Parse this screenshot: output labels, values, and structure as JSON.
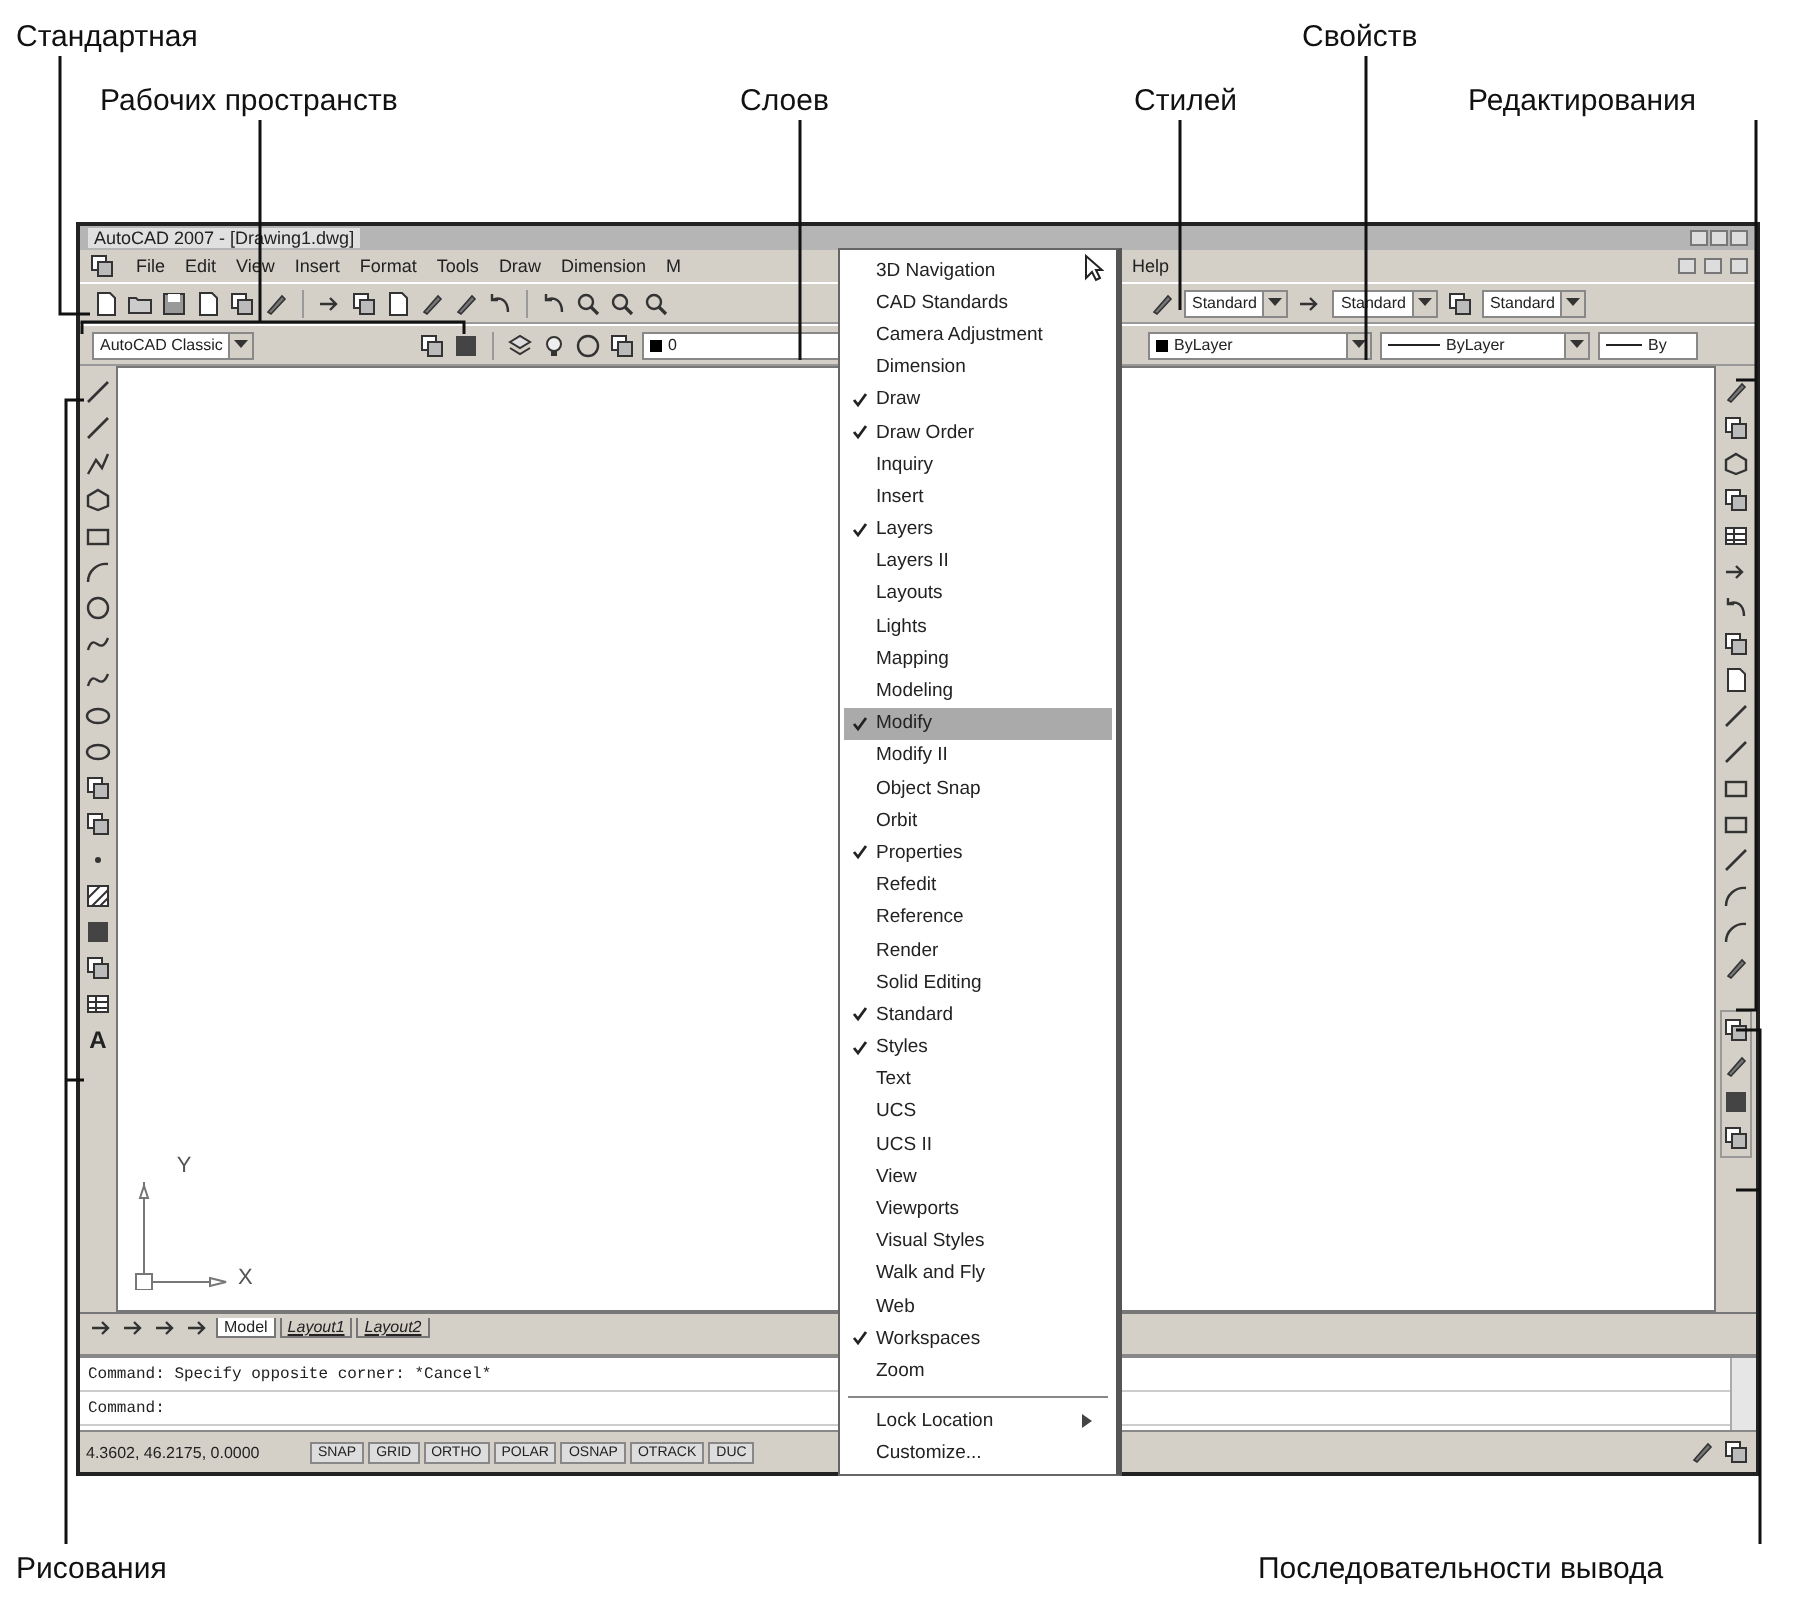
{
  "callouts": {
    "top": [
      {
        "label": "Стандартная",
        "kind": "standard"
      },
      {
        "label": "Рабочих пространств",
        "kind": "workspaces"
      },
      {
        "label": "Слоев",
        "kind": "layers"
      },
      {
        "label": "Стилей",
        "kind": "styles"
      },
      {
        "label": "Свойств",
        "kind": "properties"
      },
      {
        "label": "Редактирования",
        "kind": "modify"
      }
    ],
    "bottom": [
      {
        "label": "Рисования",
        "kind": "draw"
      },
      {
        "label": "Последовательности вывода",
        "kind": "draworder"
      }
    ]
  },
  "window": {
    "title": "AutoCAD 2007 - [Drawing1.dwg]"
  },
  "menubar": {
    "items": [
      "File",
      "Edit",
      "View",
      "Insert",
      "Format",
      "Tools",
      "Draw",
      "Dimension",
      "M"
    ],
    "right_items": [
      "Help"
    ]
  },
  "styles_toolbar": {
    "combos": [
      "Standard",
      "Standard",
      "Standard"
    ]
  },
  "workspaces_toolbar": {
    "combo": "AutoCAD Classic"
  },
  "layers_toolbar": {
    "combo": "0"
  },
  "properties_toolbar": {
    "color_dropdown": "ByLayer",
    "linetype": "ByLayer",
    "lineweight": "By"
  },
  "draw_toolbar": {
    "text_tool": "A"
  },
  "ucs": {
    "x_label": "X",
    "y_label": "Y"
  },
  "layout_tabs": [
    {
      "label": "Model",
      "selected": true
    },
    {
      "label": "Layout1",
      "selected": false
    },
    {
      "label": "Layout2",
      "selected": false
    }
  ],
  "command_lines": [
    "Command: Specify opposite corner: *Cancel*",
    "Command:"
  ],
  "status_bar": {
    "coordinates": "4.3602, 46.2175, 0.0000",
    "buttons": [
      "SNAP",
      "GRID",
      "ORTHO",
      "POLAR",
      "OSNAP",
      "OTRACK",
      "DUC"
    ]
  },
  "toolbars_menu": {
    "items": [
      {
        "label": "3D Navigation",
        "checked": false,
        "selected": false
      },
      {
        "label": "CAD Standards",
        "checked": false,
        "selected": false
      },
      {
        "label": "Camera Adjustment",
        "checked": false,
        "selected": false
      },
      {
        "label": "Dimension",
        "checked": false,
        "selected": false
      },
      {
        "label": "Draw",
        "checked": true,
        "selected": false
      },
      {
        "label": "Draw Order",
        "checked": true,
        "selected": false
      },
      {
        "label": "Inquiry",
        "checked": false,
        "selected": false
      },
      {
        "label": "Insert",
        "checked": false,
        "selected": false
      },
      {
        "label": "Layers",
        "checked": true,
        "selected": false
      },
      {
        "label": "Layers II",
        "checked": false,
        "selected": false
      },
      {
        "label": "Layouts",
        "checked": false,
        "selected": false
      },
      {
        "label": "Lights",
        "checked": false,
        "selected": false
      },
      {
        "label": "Mapping",
        "checked": false,
        "selected": false
      },
      {
        "label": "Modeling",
        "checked": false,
        "selected": false
      },
      {
        "label": "Modify",
        "checked": true,
        "selected": true
      },
      {
        "label": "Modify II",
        "checked": false,
        "selected": false
      },
      {
        "label": "Object Snap",
        "checked": false,
        "selected": false
      },
      {
        "label": "Orbit",
        "checked": false,
        "selected": false
      },
      {
        "label": "Properties",
        "checked": true,
        "selected": false
      },
      {
        "label": "Refedit",
        "checked": false,
        "selected": false
      },
      {
        "label": "Reference",
        "checked": false,
        "selected": false
      },
      {
        "label": "Render",
        "checked": false,
        "selected": false
      },
      {
        "label": "Solid Editing",
        "checked": false,
        "selected": false
      },
      {
        "label": "Standard",
        "checked": true,
        "selected": false
      },
      {
        "label": "Styles",
        "checked": true,
        "selected": false
      },
      {
        "label": "Text",
        "checked": false,
        "selected": false
      },
      {
        "label": "UCS",
        "checked": false,
        "selected": false
      },
      {
        "label": "UCS II",
        "checked": false,
        "selected": false
      },
      {
        "label": "View",
        "checked": false,
        "selected": false
      },
      {
        "label": "Viewports",
        "checked": false,
        "selected": false
      },
      {
        "label": "Visual Styles",
        "checked": false,
        "selected": false
      },
      {
        "label": "Walk and Fly",
        "checked": false,
        "selected": false
      },
      {
        "label": "Web",
        "checked": false,
        "selected": false
      },
      {
        "label": "Workspaces",
        "checked": true,
        "selected": false
      },
      {
        "label": "Zoom",
        "checked": false,
        "selected": false
      }
    ],
    "footer_items": [
      {
        "label": "Lock Location",
        "submenu": true
      },
      {
        "label": "Customize...",
        "submenu": false
      }
    ]
  }
}
